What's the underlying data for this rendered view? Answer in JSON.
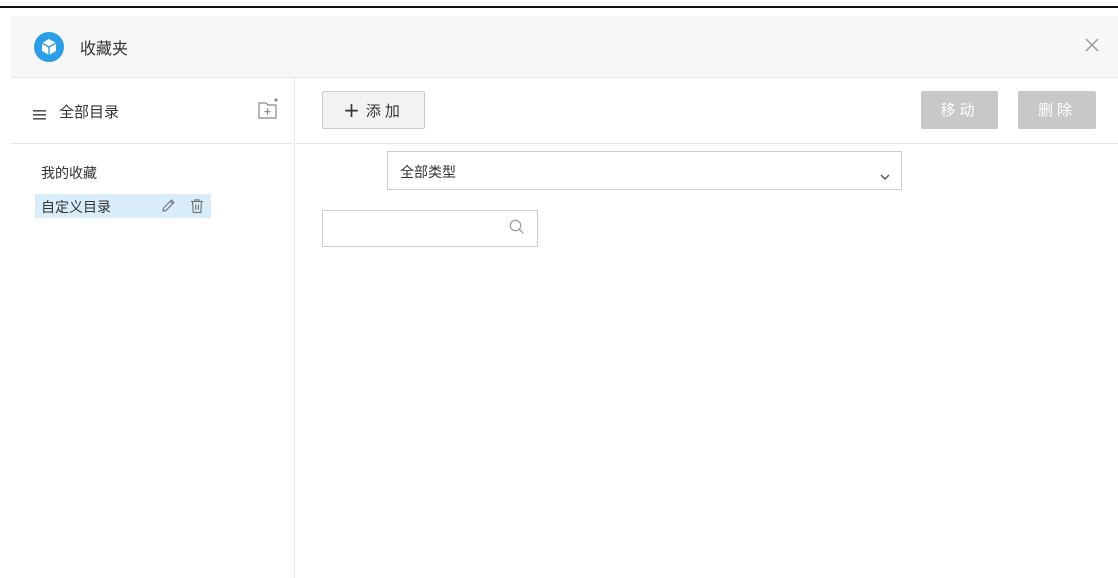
{
  "window": {
    "title": "收藏夹",
    "accent_color": "#2c9ee8"
  },
  "sidebar": {
    "header_label": "全部目录",
    "tree": {
      "root_label": "我的收藏",
      "items": [
        {
          "label": "自定义目录",
          "selected": true
        }
      ]
    }
  },
  "toolbar": {
    "add_label": "添加",
    "move_label": "移动",
    "delete_label": "删除"
  },
  "filter": {
    "type_selected": "全部类型"
  },
  "search": {
    "value": "",
    "placeholder": ""
  },
  "icons": {
    "logo": "cube-icon",
    "close": "close-icon",
    "menu": "menu-icon",
    "add_folder": "add-folder-icon",
    "edit": "pencil-icon",
    "delete": "trash-icon",
    "dropdown": "chevron-down-icon",
    "search": "search-icon"
  }
}
